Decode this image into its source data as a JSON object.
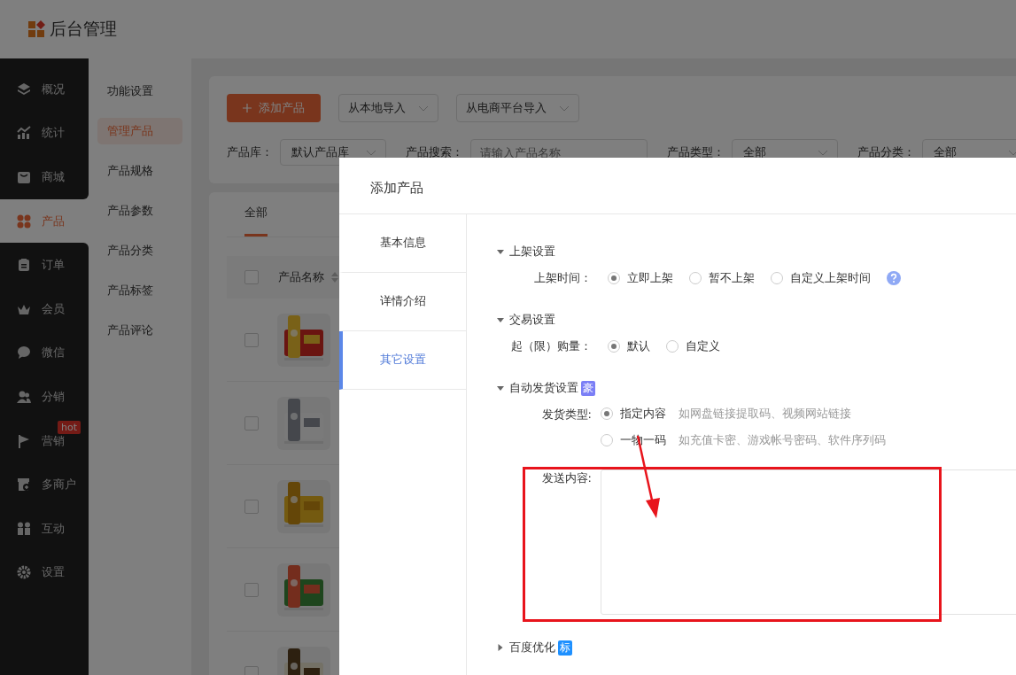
{
  "header": {
    "title": "后台管理"
  },
  "sidebar": {
    "items": [
      {
        "label": "概况",
        "selected": false
      },
      {
        "label": "统计",
        "selected": false
      },
      {
        "label": "商城",
        "selected": false
      },
      {
        "label": "产品",
        "selected": true
      },
      {
        "label": "订单",
        "selected": false
      },
      {
        "label": "会员",
        "selected": false
      },
      {
        "label": "微信",
        "selected": false
      },
      {
        "label": "分销",
        "selected": false
      },
      {
        "label": "营销",
        "selected": false,
        "badge": "hot"
      },
      {
        "label": "多商户",
        "selected": false
      },
      {
        "label": "互动",
        "selected": false
      },
      {
        "label": "设置",
        "selected": false
      }
    ]
  },
  "subnav": {
    "items": [
      {
        "label": "功能设置",
        "selected": false
      },
      {
        "label": "管理产品",
        "selected": true
      },
      {
        "label": "产品规格",
        "selected": false
      },
      {
        "label": "产品参数",
        "selected": false
      },
      {
        "label": "产品分类",
        "selected": false
      },
      {
        "label": "产品标签",
        "selected": false
      },
      {
        "label": "产品评论",
        "selected": false
      }
    ]
  },
  "toolbar": {
    "primary_button": "添加产品",
    "dropdowns": [
      "从本地导入",
      "从电商平台导入"
    ]
  },
  "filters": [
    {
      "kind": "select",
      "label": "产品库：",
      "value": "默认产品库"
    },
    {
      "kind": "search",
      "label": "产品搜索：",
      "placeholder": "请输入产品名称"
    },
    {
      "kind": "select",
      "label": "产品类型：",
      "value": "全部"
    },
    {
      "kind": "select",
      "label": "产品分类：",
      "value": "全部"
    }
  ],
  "tabs": [
    {
      "label": "全部",
      "selected": true
    }
  ],
  "table": {
    "select_all": {
      "checked": false
    },
    "columns": [
      "产品名称"
    ],
    "rows": [
      {
        "checked": false,
        "kind": "picture"
      },
      {
        "checked": false,
        "kind": "picture"
      },
      {
        "checked": false,
        "kind": "picture"
      },
      {
        "checked": false,
        "kind": "picture"
      },
      {
        "checked": false,
        "kind": "picture"
      }
    ]
  },
  "modal": {
    "title": "添加产品",
    "nav": [
      {
        "label": "基本信息",
        "selected": false
      },
      {
        "label": "详情介绍",
        "selected": false
      },
      {
        "label": "其它设置",
        "selected": true
      }
    ],
    "sections": [
      {
        "title": "上架设置",
        "expanded": true,
        "fields": [
          {
            "kind": "radio",
            "label": "上架时间：",
            "help": true,
            "options": [
              {
                "label": "立即上架",
                "selected": true
              },
              {
                "label": "暂不上架",
                "selected": false
              },
              {
                "label": "自定义上架时间",
                "selected": false
              }
            ]
          }
        ]
      },
      {
        "title": "交易设置",
        "expanded": true,
        "fields": [
          {
            "kind": "radio",
            "label": "起（限）购量：",
            "options": [
              {
                "label": "默认",
                "selected": true
              },
              {
                "label": "自定义",
                "selected": false
              }
            ]
          }
        ]
      },
      {
        "title": "自动发货设置",
        "expanded": true,
        "badge": {
          "text": "豪",
          "color": "#7b7ff6"
        },
        "fields": [
          {
            "kind": "radio_stacked",
            "label": "发货类型:",
            "options": [
              {
                "label": "指定内容",
                "hint": "如网盘链接提取码、视频网站链接",
                "selected": true
              },
              {
                "label": "一物一码",
                "hint": "如充值卡密、游戏帐号密码、软件序列码",
                "selected": false
              }
            ]
          },
          {
            "kind": "textarea",
            "label": "发送内容:"
          }
        ]
      },
      {
        "title": "百度优化",
        "expanded": false,
        "badge": {
          "text": "标",
          "color": "#1e90ff"
        }
      }
    ]
  }
}
